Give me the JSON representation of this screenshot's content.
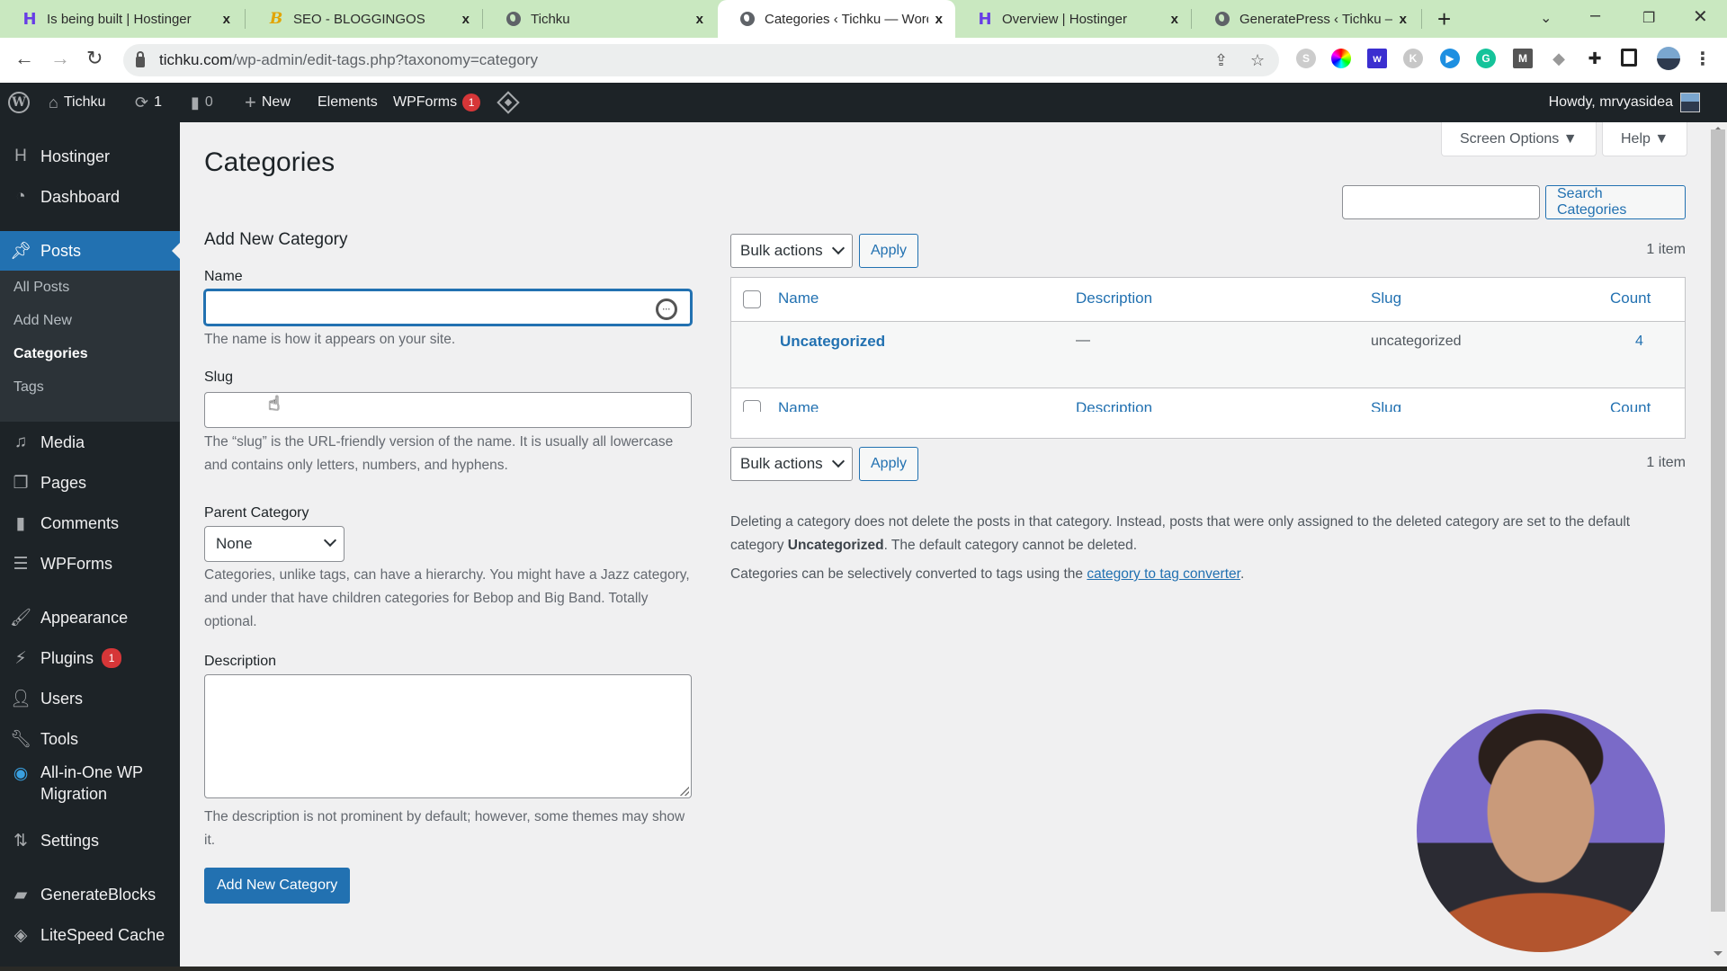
{
  "browser": {
    "tabs": [
      {
        "title": "Is being built | Hostinger",
        "icon": "hostinger-icon",
        "active": false
      },
      {
        "title": "SEO - BLOGGINGOS",
        "icon": "bloggingos-icon",
        "active": false
      },
      {
        "title": "Tichku",
        "icon": "globe-icon",
        "active": false
      },
      {
        "title": "Categories ‹ Tichku — Word",
        "icon": "globe-icon",
        "active": true
      },
      {
        "title": "Overview | Hostinger",
        "icon": "hostinger-icon",
        "active": false
      },
      {
        "title": "GeneratePress ‹ Tichku — V",
        "icon": "globe-icon",
        "active": false
      }
    ],
    "close_glyph": "x",
    "new_tab_glyph": "+",
    "url_domain": "tichku.com",
    "url_path": "/wp-admin/edit-tags.php?taxonomy=category",
    "extensions": [
      "shield-extension",
      "color-picker-extension",
      "wordtune-extension",
      "k-extension",
      "video-extension",
      "grammarly-extension",
      "m-extension",
      "fox-extension",
      "puzzle-extension",
      "sidepanel-extension",
      "profile-avatar"
    ]
  },
  "adminbar": {
    "site_name": "Tichku",
    "updates_count": "1",
    "comments_count": "0",
    "new_label": "New",
    "elements_label": "Elements",
    "wpforms_label": "WPForms",
    "wpforms_badge": "1",
    "howdy": "Howdy, mrvyasidea"
  },
  "sidebar": {
    "items": [
      {
        "label": "Hostinger",
        "icon": "hostinger-icon"
      },
      {
        "label": "Dashboard",
        "icon": "dashboard-icon"
      },
      {
        "label": "Posts",
        "icon": "pin-icon",
        "current": true
      },
      {
        "label": "Media",
        "icon": "media-icon"
      },
      {
        "label": "Pages",
        "icon": "pages-icon"
      },
      {
        "label": "Comments",
        "icon": "comments-icon"
      },
      {
        "label": "WPForms",
        "icon": "wpforms-icon"
      },
      {
        "label": "Appearance",
        "icon": "appearance-icon"
      },
      {
        "label": "Plugins",
        "icon": "plugins-icon",
        "badge": "1"
      },
      {
        "label": "Users",
        "icon": "users-icon"
      },
      {
        "label": "Tools",
        "icon": "tools-icon"
      },
      {
        "label": "All-in-One WP",
        "label2": "Migration",
        "icon": "migration-icon"
      },
      {
        "label": "Settings",
        "icon": "settings-icon"
      },
      {
        "label": "GenerateBlocks",
        "icon": "generateblocks-icon"
      },
      {
        "label": "LiteSpeed Cache",
        "icon": "litespeed-icon"
      }
    ],
    "posts_submenu": [
      {
        "label": "All Posts"
      },
      {
        "label": "Add New"
      },
      {
        "label": "Categories",
        "current": true
      },
      {
        "label": "Tags"
      }
    ]
  },
  "page": {
    "title": "Categories",
    "screen_options": "Screen Options ▼",
    "help": "Help ▼"
  },
  "form": {
    "heading": "Add New Category",
    "name_label": "Name",
    "name_value": "",
    "name_help": "The name is how it appears on your site.",
    "slug_label": "Slug",
    "slug_value": "",
    "slug_help": "The “slug” is the URL-friendly version of the name. It is usually all lowercase and contains only letters, numbers, and hyphens.",
    "parent_label": "Parent Category",
    "parent_value": "None",
    "parent_help": "Categories, unlike tags, can have a hierarchy. You might have a Jazz category, and under that have children categories for Bebop and Big Band. Totally optional.",
    "description_label": "Description",
    "description_value": "",
    "description_help": "The description is not prominent by default; however, some themes may show it.",
    "submit_label": "Add New Category"
  },
  "list": {
    "search_value": "",
    "search_button": "Search Categories",
    "bulk_actions": "Bulk actions",
    "apply": "Apply",
    "items_count": "1 item",
    "columns": {
      "name": "Name",
      "description": "Description",
      "slug": "Slug",
      "count": "Count"
    },
    "rows": [
      {
        "name": "Uncategorized",
        "description": "—",
        "slug": "uncategorized",
        "count": "4"
      }
    ],
    "note1_pre": "Deleting a category does not delete the posts in that category. Instead, posts that were only assigned to the deleted category are set to the default category ",
    "note1_bold": "Uncategorized",
    "note1_post": ". The default category cannot be deleted.",
    "note2_pre": "Categories can be selectively converted to tags using the ",
    "note2_link": "category to tag converter",
    "note2_post": "."
  },
  "colors": {
    "wp_blue": "#2271b1",
    "admin_dark": "#1d2327",
    "badge_red": "#d63638",
    "tabstrip_green": "#c9e8c0"
  }
}
